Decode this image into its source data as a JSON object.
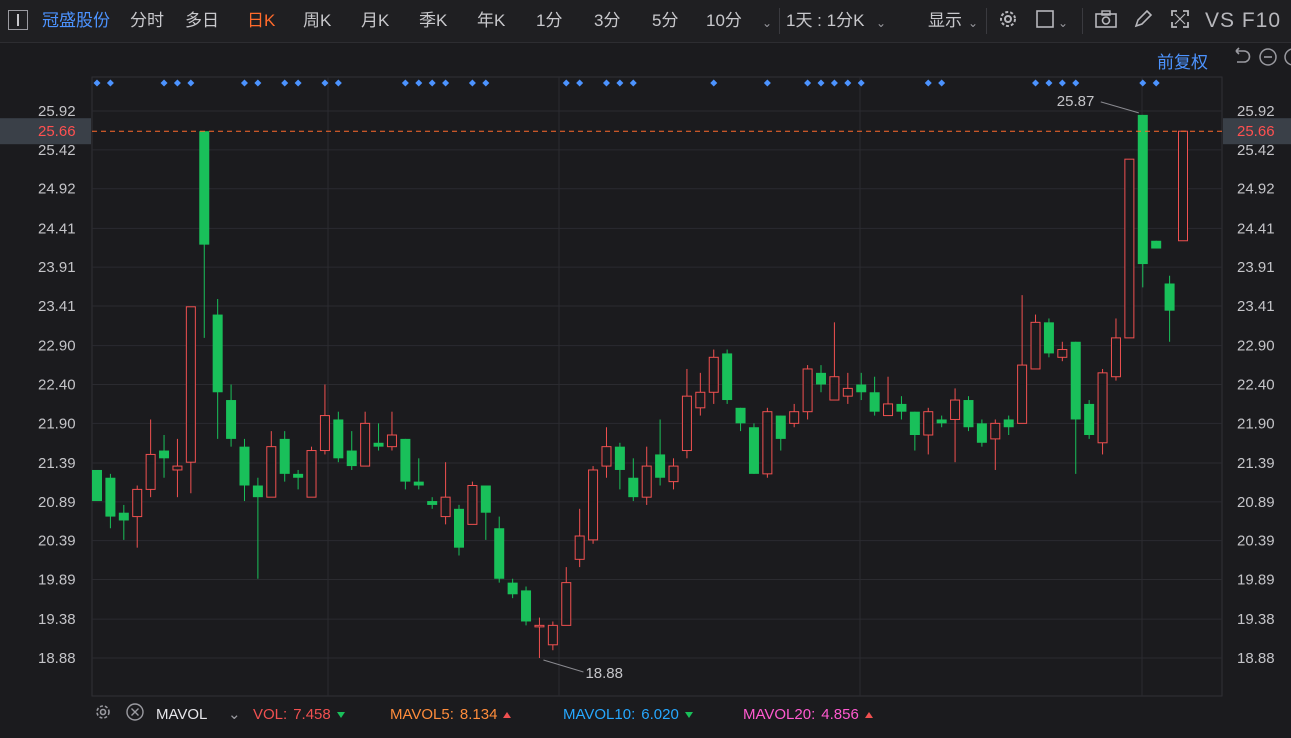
{
  "toolbar": {
    "stock_name": "冠盛股份",
    "periods": [
      "分时",
      "多日",
      "日K",
      "周K",
      "月K",
      "季K",
      "年K",
      "1分",
      "3分",
      "5分",
      "10分"
    ],
    "active_period": "日K",
    "range_select": "1天 : 1分K",
    "display_label": "显示",
    "brand": "VS F10"
  },
  "subbar": {
    "adjust_label": "前复权"
  },
  "indicator": {
    "name": "MAVOL",
    "vol_label": "VOL:",
    "vol_value": "7.458",
    "mavol5_label": "MAVOL5:",
    "mavol5_value": "8.134",
    "mavol10_label": "MAVOL10:",
    "mavol10_value": "6.020",
    "mavol20_label": "MAVOL20:",
    "mavol20_value": "4.856"
  },
  "colors": {
    "up": "#f05050",
    "down": "#19c05a",
    "accent": "#ff6a2b",
    "link": "#4c93ff",
    "current_line": "#ff6a2b",
    "current_label_bg": "#3a4048",
    "mavol5": "#ff8c3b",
    "mavol10": "#26a8ff",
    "mavol20": "#ff5ad0"
  },
  "chart_data": {
    "type": "candlestick",
    "y_ticks": [
      "25.92",
      "25.42",
      "24.92",
      "24.41",
      "23.91",
      "23.41",
      "22.90",
      "22.40",
      "21.90",
      "21.39",
      "20.89",
      "20.39",
      "19.89",
      "19.38",
      "18.88"
    ],
    "current_price": "25.66",
    "max_label": "25.87",
    "min_label": "18.88",
    "candles": [
      [
        21.3,
        20.9,
        21.3,
        20.9
      ],
      [
        21.2,
        20.7,
        21.25,
        20.55
      ],
      [
        20.75,
        20.65,
        20.85,
        20.4
      ],
      [
        20.7,
        21.05,
        21.1,
        20.3
      ],
      [
        21.05,
        21.5,
        21.95,
        20.95
      ],
      [
        21.55,
        21.45,
        21.75,
        21.2
      ],
      [
        21.3,
        21.35,
        21.7,
        20.95
      ],
      [
        21.4,
        23.4,
        23.4,
        21.0
      ],
      [
        25.66,
        24.2,
        25.66,
        23.0
      ],
      [
        23.3,
        22.3,
        23.5,
        21.7
      ],
      [
        22.2,
        21.7,
        22.4,
        21.6
      ],
      [
        21.6,
        21.1,
        21.7,
        20.9
      ],
      [
        21.1,
        20.95,
        21.2,
        19.9
      ],
      [
        20.95,
        21.6,
        21.8,
        20.95
      ],
      [
        21.7,
        21.25,
        21.8,
        21.15
      ],
      [
        21.25,
        21.2,
        21.3,
        21.05
      ],
      [
        20.95,
        21.55,
        21.6,
        20.95
      ],
      [
        21.55,
        22.0,
        22.4,
        21.5
      ],
      [
        21.95,
        21.45,
        22.05,
        21.4
      ],
      [
        21.55,
        21.35,
        21.8,
        21.3
      ],
      [
        21.35,
        21.9,
        22.05,
        21.35
      ],
      [
        21.65,
        21.6,
        21.9,
        21.55
      ],
      [
        21.6,
        21.75,
        22.05,
        21.55
      ],
      [
        21.7,
        21.15,
        21.7,
        21.05
      ],
      [
        21.15,
        21.1,
        21.45,
        21.05
      ],
      [
        20.9,
        20.85,
        20.95,
        20.8
      ],
      [
        20.7,
        20.95,
        21.4,
        20.6
      ],
      [
        20.8,
        20.3,
        20.85,
        20.2
      ],
      [
        20.6,
        21.1,
        21.15,
        20.7
      ],
      [
        21.1,
        20.75,
        21.1,
        20.4
      ],
      [
        20.55,
        19.9,
        20.7,
        19.85
      ],
      [
        19.85,
        19.7,
        19.9,
        19.65
      ],
      [
        19.75,
        19.35,
        19.8,
        19.3
      ],
      [
        19.3,
        19.3,
        19.4,
        18.88
      ],
      [
        19.05,
        19.3,
        19.35,
        18.98
      ],
      [
        19.3,
        19.85,
        20.05,
        19.3
      ],
      [
        20.15,
        20.45,
        20.8,
        20.05
      ],
      [
        20.4,
        21.3,
        21.35,
        20.35
      ],
      [
        21.35,
        21.6,
        21.85,
        21.2
      ],
      [
        21.6,
        21.3,
        21.65,
        21.05
      ],
      [
        21.2,
        20.95,
        21.45,
        20.9
      ],
      [
        20.95,
        21.35,
        21.6,
        20.85
      ],
      [
        21.5,
        21.2,
        21.95,
        21.1
      ],
      [
        21.15,
        21.35,
        21.45,
        21.05
      ],
      [
        21.55,
        22.25,
        22.6,
        21.45
      ],
      [
        22.1,
        22.3,
        22.55,
        22.0
      ],
      [
        22.3,
        22.75,
        22.85,
        22.15
      ],
      [
        22.8,
        22.2,
        22.85,
        22.15
      ],
      [
        22.1,
        21.9,
        22.1,
        21.8
      ],
      [
        21.85,
        21.25,
        21.9,
        21.25
      ],
      [
        21.25,
        22.05,
        22.1,
        21.2
      ],
      [
        22.0,
        21.7,
        22.0,
        21.55
      ],
      [
        21.9,
        22.05,
        22.15,
        21.85
      ],
      [
        22.05,
        22.6,
        22.65,
        21.95
      ],
      [
        22.55,
        22.4,
        22.65,
        22.3
      ],
      [
        22.2,
        22.5,
        23.2,
        22.2
      ],
      [
        22.25,
        22.35,
        22.55,
        22.15
      ],
      [
        22.4,
        22.3,
        22.55,
        22.2
      ],
      [
        22.3,
        22.05,
        22.5,
        22.0
      ],
      [
        22.0,
        22.15,
        22.5,
        22.0
      ],
      [
        22.15,
        22.05,
        22.25,
        21.95
      ],
      [
        22.05,
        21.75,
        22.05,
        21.55
      ],
      [
        21.75,
        22.05,
        22.1,
        21.5
      ],
      [
        21.95,
        21.9,
        22.0,
        21.85
      ],
      [
        21.95,
        22.2,
        22.35,
        21.4
      ],
      [
        22.2,
        21.85,
        22.25,
        21.8
      ],
      [
        21.9,
        21.65,
        21.95,
        21.6
      ],
      [
        21.7,
        21.9,
        21.95,
        21.3
      ],
      [
        21.95,
        21.85,
        22.0,
        21.75
      ],
      [
        21.9,
        22.65,
        23.55,
        21.9
      ],
      [
        22.6,
        23.2,
        23.3,
        22.6
      ],
      [
        23.2,
        22.8,
        23.25,
        22.75
      ],
      [
        22.75,
        22.85,
        22.95,
        22.7
      ],
      [
        22.95,
        21.95,
        22.95,
        21.25
      ],
      [
        22.15,
        21.75,
        22.2,
        21.7
      ],
      [
        21.65,
        22.55,
        22.6,
        21.5
      ],
      [
        22.5,
        23.0,
        23.25,
        22.45
      ],
      [
        23.0,
        25.3,
        25.3,
        23.0
      ],
      [
        25.87,
        23.95,
        25.87,
        23.65
      ],
      [
        24.25,
        24.15,
        24.25,
        24.15
      ],
      [
        23.7,
        23.35,
        23.8,
        22.95
      ],
      [
        24.25,
        25.66,
        25.66,
        24.25
      ]
    ],
    "marker_slots": [
      0,
      1,
      5,
      6,
      7,
      11,
      12,
      14,
      15,
      17,
      18,
      23,
      24,
      25,
      26,
      28,
      29,
      35,
      36,
      38,
      39,
      40,
      46,
      50,
      53,
      54,
      55,
      56,
      57,
      62,
      63,
      70,
      71,
      72,
      73,
      78,
      79
    ]
  }
}
